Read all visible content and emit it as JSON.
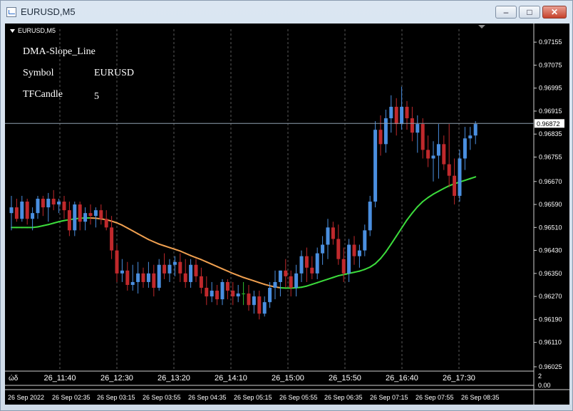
{
  "window": {
    "title": "EURUSD,M5",
    "min_glyph": "–",
    "max_glyph": "□",
    "close_glyph": "✕"
  },
  "chart": {
    "label": "EURUSD,M5",
    "current_price": "0.96872",
    "price_ticks": [
      "0.97155",
      "0.97075",
      "0.96995",
      "0.96915",
      "0.96835",
      "0.96755",
      "0.96670",
      "0.96590",
      "0.96510",
      "0.96430",
      "0.96350",
      "0.96270",
      "0.96190",
      "0.96110",
      "0.96025"
    ],
    "time_ticks": [
      "26_11:40",
      "26_12:30",
      "26_13:20",
      "26_14:10",
      "26_15:00",
      "26_15:50",
      "26_16:40",
      "26_17:30"
    ],
    "time_ticks_start": "ώδ",
    "date_ticks": [
      "26 Sep 2022",
      "26 Sep 02:35",
      "26 Sep 03:15",
      "26 Sep 03:55",
      "26 Sep 04:35",
      "26 Sep 05:15",
      "26 Sep 05:55",
      "26 Sep 06:35",
      "26 Sep 07:15",
      "26 Sep 07:55",
      "26 Sep 08:35"
    ],
    "sub_scale": [
      "2",
      "0.00"
    ]
  },
  "indicator": {
    "name": "DMA-Slope_Line",
    "symbol_label": "Symbol",
    "symbol_value": "EURUSD",
    "tf_label": "TFCandle",
    "tf_value": "5"
  },
  "colors": {
    "bull": "#4a8fe0",
    "bear": "#c0292c",
    "neutral": "#2fbf2f",
    "ma_up": "#3cdc3c",
    "ma_down": "#f0a050",
    "grid": "#5a5a5a",
    "price_line": "#8fa0b0"
  },
  "chart_data": {
    "type": "candlestick",
    "symbol": "EURUSD",
    "timeframe": "M5",
    "ylim": [
      0.9601,
      0.972
    ],
    "candles": [
      {
        "o": 0.9656,
        "h": 0.9662,
        "l": 0.965,
        "c": 0.9658
      },
      {
        "o": 0.9658,
        "h": 0.9661,
        "l": 0.9653,
        "c": 0.9654
      },
      {
        "o": 0.9654,
        "h": 0.9662,
        "l": 0.9653,
        "c": 0.966
      },
      {
        "o": 0.966,
        "h": 0.9661,
        "l": 0.9652,
        "c": 0.9654
      },
      {
        "o": 0.9654,
        "h": 0.9658,
        "l": 0.965,
        "c": 0.9656
      },
      {
        "o": 0.9656,
        "h": 0.9662,
        "l": 0.9654,
        "c": 0.9661
      },
      {
        "o": 0.9661,
        "h": 0.9662,
        "l": 0.9655,
        "c": 0.9658
      },
      {
        "o": 0.9658,
        "h": 0.9663,
        "l": 0.9653,
        "c": 0.9661
      },
      {
        "o": 0.9661,
        "h": 0.9664,
        "l": 0.9657,
        "c": 0.9659
      },
      {
        "o": 0.9659,
        "h": 0.9661,
        "l": 0.9656,
        "c": 0.966
      },
      {
        "o": 0.966,
        "h": 0.9662,
        "l": 0.9654,
        "c": 0.9657
      },
      {
        "o": 0.9657,
        "h": 0.966,
        "l": 0.9648,
        "c": 0.965
      },
      {
        "o": 0.965,
        "h": 0.966,
        "l": 0.9648,
        "c": 0.9659
      },
      {
        "o": 0.9659,
        "h": 0.966,
        "l": 0.965,
        "c": 0.9653
      },
      {
        "o": 0.9653,
        "h": 0.9658,
        "l": 0.965,
        "c": 0.9656
      },
      {
        "o": 0.9656,
        "h": 0.9659,
        "l": 0.9652,
        "c": 0.9655
      },
      {
        "o": 0.9655,
        "h": 0.9658,
        "l": 0.9651,
        "c": 0.9657
      },
      {
        "o": 0.9657,
        "h": 0.9659,
        "l": 0.9652,
        "c": 0.9654
      },
      {
        "o": 0.9654,
        "h": 0.9657,
        "l": 0.965,
        "c": 0.9651
      },
      {
        "o": 0.9651,
        "h": 0.9655,
        "l": 0.964,
        "c": 0.9643
      },
      {
        "o": 0.9643,
        "h": 0.9645,
        "l": 0.9632,
        "c": 0.9635
      },
      {
        "o": 0.9635,
        "h": 0.964,
        "l": 0.9632,
        "c": 0.9636
      },
      {
        "o": 0.9636,
        "h": 0.9639,
        "l": 0.9629,
        "c": 0.9631
      },
      {
        "o": 0.9631,
        "h": 0.9638,
        "l": 0.9629,
        "c": 0.9632
      },
      {
        "o": 0.9632,
        "h": 0.9639,
        "l": 0.9628,
        "c": 0.9635
      },
      {
        "o": 0.9635,
        "h": 0.9637,
        "l": 0.963,
        "c": 0.9632
      },
      {
        "o": 0.9632,
        "h": 0.9639,
        "l": 0.963,
        "c": 0.9635
      },
      {
        "o": 0.9635,
        "h": 0.9638,
        "l": 0.9627,
        "c": 0.963
      },
      {
        "o": 0.963,
        "h": 0.964,
        "l": 0.9629,
        "c": 0.9638
      },
      {
        "o": 0.9638,
        "h": 0.9642,
        "l": 0.9633,
        "c": 0.9635
      },
      {
        "o": 0.9635,
        "h": 0.964,
        "l": 0.9632,
        "c": 0.9638
      },
      {
        "o": 0.9638,
        "h": 0.9641,
        "l": 0.9634,
        "c": 0.9639
      },
      {
        "o": 0.9639,
        "h": 0.9642,
        "l": 0.9632,
        "c": 0.9635
      },
      {
        "o": 0.9635,
        "h": 0.964,
        "l": 0.963,
        "c": 0.9632
      },
      {
        "o": 0.9632,
        "h": 0.964,
        "l": 0.963,
        "c": 0.9638
      },
      {
        "o": 0.9638,
        "h": 0.964,
        "l": 0.9632,
        "c": 0.9634
      },
      {
        "o": 0.9634,
        "h": 0.9637,
        "l": 0.9628,
        "c": 0.963
      },
      {
        "o": 0.963,
        "h": 0.9634,
        "l": 0.9624,
        "c": 0.9627
      },
      {
        "o": 0.9627,
        "h": 0.9632,
        "l": 0.9625,
        "c": 0.9629
      },
      {
        "o": 0.9629,
        "h": 0.9631,
        "l": 0.9624,
        "c": 0.9626
      },
      {
        "o": 0.9626,
        "h": 0.9633,
        "l": 0.9624,
        "c": 0.9632
      },
      {
        "o": 0.9632,
        "h": 0.9633,
        "l": 0.9626,
        "c": 0.9629
      },
      {
        "o": 0.9629,
        "h": 0.9632,
        "l": 0.9624,
        "c": 0.9627
      },
      {
        "o": 0.9627,
        "h": 0.9631,
        "l": 0.9625,
        "c": 0.9628
      },
      {
        "o": 0.9628,
        "h": 0.9632,
        "l": 0.9624,
        "c": 0.9628
      },
      {
        "o": 0.9628,
        "h": 0.9631,
        "l": 0.9622,
        "c": 0.9624
      },
      {
        "o": 0.9624,
        "h": 0.9629,
        "l": 0.9621,
        "c": 0.9627
      },
      {
        "o": 0.9627,
        "h": 0.9629,
        "l": 0.9619,
        "c": 0.9621
      },
      {
        "o": 0.9621,
        "h": 0.9627,
        "l": 0.962,
        "c": 0.9625
      },
      {
        "o": 0.9625,
        "h": 0.9632,
        "l": 0.9623,
        "c": 0.963
      },
      {
        "o": 0.963,
        "h": 0.9636,
        "l": 0.9626,
        "c": 0.9632
      },
      {
        "o": 0.9632,
        "h": 0.9636,
        "l": 0.9627,
        "c": 0.9636
      },
      {
        "o": 0.9636,
        "h": 0.964,
        "l": 0.963,
        "c": 0.9634
      },
      {
        "o": 0.9634,
        "h": 0.9636,
        "l": 0.9627,
        "c": 0.963
      },
      {
        "o": 0.963,
        "h": 0.9638,
        "l": 0.9627,
        "c": 0.9635
      },
      {
        "o": 0.9635,
        "h": 0.9643,
        "l": 0.9632,
        "c": 0.9641
      },
      {
        "o": 0.9641,
        "h": 0.9644,
        "l": 0.9632,
        "c": 0.9637
      },
      {
        "o": 0.9637,
        "h": 0.9641,
        "l": 0.9633,
        "c": 0.9635
      },
      {
        "o": 0.9635,
        "h": 0.9644,
        "l": 0.9633,
        "c": 0.9642
      },
      {
        "o": 0.9642,
        "h": 0.9648,
        "l": 0.9638,
        "c": 0.9645
      },
      {
        "o": 0.9645,
        "h": 0.9654,
        "l": 0.964,
        "c": 0.9651
      },
      {
        "o": 0.9651,
        "h": 0.9653,
        "l": 0.9645,
        "c": 0.9647
      },
      {
        "o": 0.9647,
        "h": 0.9652,
        "l": 0.9638,
        "c": 0.964
      },
      {
        "o": 0.964,
        "h": 0.9644,
        "l": 0.9632,
        "c": 0.9635
      },
      {
        "o": 0.9635,
        "h": 0.9647,
        "l": 0.9632,
        "c": 0.9645
      },
      {
        "o": 0.9645,
        "h": 0.9648,
        "l": 0.9638,
        "c": 0.9641
      },
      {
        "o": 0.9641,
        "h": 0.9645,
        "l": 0.9637,
        "c": 0.9643
      },
      {
        "o": 0.9643,
        "h": 0.9652,
        "l": 0.9641,
        "c": 0.965
      },
      {
        "o": 0.965,
        "h": 0.9662,
        "l": 0.9648,
        "c": 0.966
      },
      {
        "o": 0.966,
        "h": 0.9688,
        "l": 0.9658,
        "c": 0.9685
      },
      {
        "o": 0.9685,
        "h": 0.969,
        "l": 0.9676,
        "c": 0.968
      },
      {
        "o": 0.968,
        "h": 0.9692,
        "l": 0.9677,
        "c": 0.9689
      },
      {
        "o": 0.9689,
        "h": 0.9697,
        "l": 0.9684,
        "c": 0.9693
      },
      {
        "o": 0.9693,
        "h": 0.9696,
        "l": 0.9683,
        "c": 0.9687
      },
      {
        "o": 0.9687,
        "h": 0.97,
        "l": 0.9685,
        "c": 0.9693
      },
      {
        "o": 0.9693,
        "h": 0.9695,
        "l": 0.9685,
        "c": 0.9689
      },
      {
        "o": 0.9689,
        "h": 0.9693,
        "l": 0.9681,
        "c": 0.9684
      },
      {
        "o": 0.9684,
        "h": 0.969,
        "l": 0.9677,
        "c": 0.9687
      },
      {
        "o": 0.9687,
        "h": 0.9689,
        "l": 0.9675,
        "c": 0.9678
      },
      {
        "o": 0.9678,
        "h": 0.9683,
        "l": 0.9672,
        "c": 0.9675
      },
      {
        "o": 0.9675,
        "h": 0.9681,
        "l": 0.9667,
        "c": 0.9676
      },
      {
        "o": 0.9676,
        "h": 0.9687,
        "l": 0.9668,
        "c": 0.968
      },
      {
        "o": 0.968,
        "h": 0.9683,
        "l": 0.9671,
        "c": 0.9673
      },
      {
        "o": 0.9673,
        "h": 0.9687,
        "l": 0.9665,
        "c": 0.9669
      },
      {
        "o": 0.9669,
        "h": 0.9675,
        "l": 0.9659,
        "c": 0.9662
      },
      {
        "o": 0.9662,
        "h": 0.9678,
        "l": 0.966,
        "c": 0.9675
      },
      {
        "o": 0.9675,
        "h": 0.9686,
        "l": 0.9671,
        "c": 0.9682
      },
      {
        "o": 0.9682,
        "h": 0.9686,
        "l": 0.9678,
        "c": 0.9683
      },
      {
        "o": 0.9683,
        "h": 0.9688,
        "l": 0.968,
        "c": 0.9687
      }
    ],
    "moving_average": [
      0.9651,
      0.9651,
      0.9651,
      0.9651,
      0.9651,
      0.96512,
      0.96516,
      0.9652,
      0.96525,
      0.9653,
      0.96534,
      0.96537,
      0.9654,
      0.96542,
      0.96543,
      0.96543,
      0.96542,
      0.9654,
      0.96537,
      0.96532,
      0.96526,
      0.96518,
      0.96508,
      0.96498,
      0.96488,
      0.96478,
      0.96468,
      0.9646,
      0.96452,
      0.96446,
      0.9644,
      0.96434,
      0.96428,
      0.9642,
      0.96412,
      0.96405,
      0.96398,
      0.9639,
      0.96382,
      0.96374,
      0.96366,
      0.96358,
      0.9635,
      0.96343,
      0.96336,
      0.9633,
      0.96324,
      0.96318,
      0.96312,
      0.96307,
      0.96303,
      0.963,
      0.96299,
      0.96299,
      0.963,
      0.96302,
      0.96306,
      0.96312,
      0.96318,
      0.96324,
      0.9633,
      0.96336,
      0.96342,
      0.96346,
      0.9635,
      0.96354,
      0.96358,
      0.96364,
      0.96372,
      0.96384,
      0.96402,
      0.96425,
      0.96452,
      0.9648,
      0.96508,
      0.96536,
      0.9656,
      0.96582,
      0.966,
      0.96614,
      0.96626,
      0.96636,
      0.96646,
      0.96655,
      0.96662,
      0.96668,
      0.96674,
      0.9668,
      0.96686
    ],
    "ma_direction": [
      "up",
      "up",
      "up",
      "up",
      "up",
      "up",
      "up",
      "up",
      "up",
      "up",
      "up",
      "up",
      "up",
      "up",
      "up",
      "down",
      "down",
      "down",
      "down",
      "down",
      "down",
      "down",
      "down",
      "down",
      "down",
      "down",
      "down",
      "down",
      "down",
      "down",
      "down",
      "down",
      "down",
      "down",
      "down",
      "down",
      "down",
      "down",
      "down",
      "down",
      "down",
      "down",
      "down",
      "down",
      "down",
      "down",
      "down",
      "down",
      "down",
      "down",
      "down",
      "up",
      "up",
      "up",
      "up",
      "up",
      "up",
      "up",
      "up",
      "up",
      "up",
      "up",
      "up",
      "up",
      "up",
      "up",
      "up",
      "up",
      "up",
      "up",
      "up",
      "up",
      "up",
      "up",
      "up",
      "up",
      "up",
      "up",
      "up",
      "up",
      "up",
      "up",
      "up",
      "up",
      "up",
      "up",
      "up",
      "up",
      "up"
    ]
  }
}
